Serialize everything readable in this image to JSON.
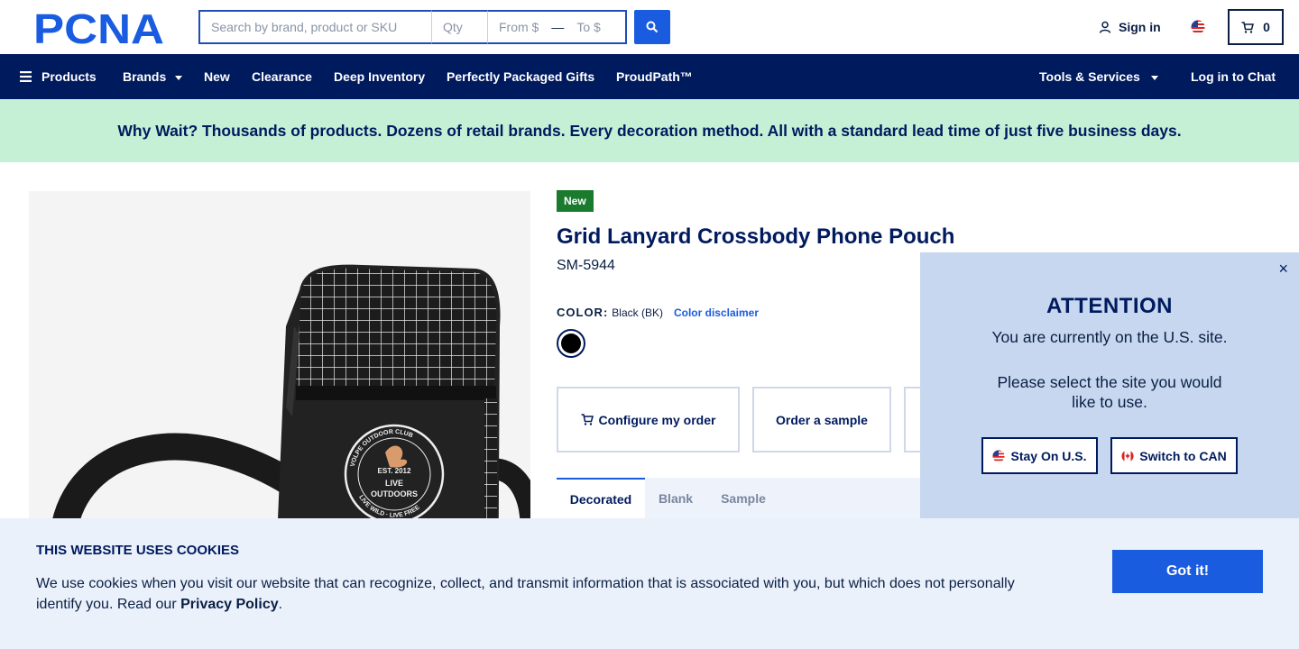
{
  "header": {
    "logo_text": "PCNA",
    "search_placeholder": "Search by brand, product or SKU",
    "qty_placeholder": "Qty",
    "from_placeholder": "From $",
    "range_dash": "—",
    "to_placeholder": "To $",
    "sign_in": "Sign in",
    "cart_count": "0"
  },
  "nav": {
    "products": "Products",
    "brands": "Brands",
    "new": "New",
    "clearance": "Clearance",
    "deep_inventory": "Deep Inventory",
    "gifts": "Perfectly Packaged Gifts",
    "proudpath": "ProudPath™",
    "tools": "Tools & Services",
    "chat": "Log in to Chat"
  },
  "banner": {
    "text": "Why Wait? Thousands of products. Dozens of retail brands. Every decoration method. All with a standard lead time of just five business days."
  },
  "product": {
    "badge": "New",
    "title": "Grid Lanyard Crossbody Phone Pouch",
    "sku": "SM-5944",
    "color_label": "COLOR:",
    "color_value": "Black (BK)",
    "color_disclaimer": "Color disclaimer",
    "swatch_color": "#000000",
    "image_badge_lines": [
      "VOLPE OUTDOOR CLUB",
      "EST. 2012",
      "LIVE",
      "OUTDOORS",
      "LIVE WILD · LIVE FREE"
    ]
  },
  "actions": {
    "configure": "Configure my order",
    "sample": "Order a sample"
  },
  "tabs": [
    "Decorated",
    "Blank",
    "Sample"
  ],
  "attention": {
    "close": "×",
    "heading": "ATTENTION",
    "msg1": "You are currently on the U.S. site.",
    "msg2": "Please select the site you would like to use.",
    "stay": "Stay On U.S.",
    "switch": "Switch to CAN"
  },
  "cookie": {
    "title": "THIS WEBSITE USES COOKIES",
    "text_before": "We use cookies when you visit our website that can recognize, collect, and transmit information that is associated with you, but which does not personally identify you. Read our ",
    "link": "Privacy Policy",
    "text_after": ".",
    "button": "Got it!"
  },
  "colors": {
    "brand_navy": "#001a5e",
    "accent_blue": "#1a5ce0",
    "banner_green": "#c6f0d6",
    "new_badge_green": "#1a7a2e"
  }
}
